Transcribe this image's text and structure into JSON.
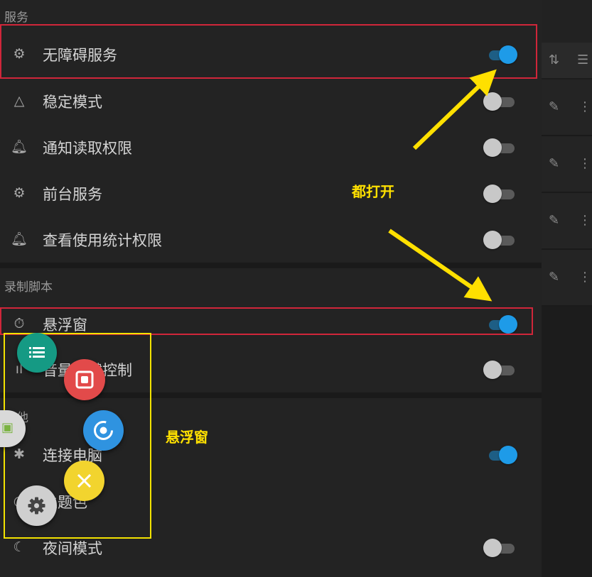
{
  "sections": {
    "services": "服务",
    "record_script": "录制脚本",
    "other": "其他"
  },
  "rows": {
    "accessibility": "无障碍服务",
    "stable_mode": "稳定模式",
    "notification_read": "通知读取权限",
    "foreground_service": "前台服务",
    "usage_stats": "查看使用统计权限",
    "floating_window": "悬浮窗",
    "volume_key_control": "音量上键控制",
    "connect_computer": "连接电脑",
    "theme_color": "主题色",
    "night_mode": "夜间模式"
  },
  "toggles": {
    "accessibility": true,
    "stable_mode": false,
    "notification_read": false,
    "foreground_service": false,
    "usage_stats": false,
    "floating_window": true,
    "volume_key_control": false,
    "connect_computer": true,
    "night_mode": false
  },
  "annotations": {
    "turn_all_on": "都打开",
    "floating_window": "悬浮窗"
  },
  "colors": {
    "toggle_on": "#1e9be8",
    "highlight_red": "#d0263a",
    "annotation_yellow": "#ffe000",
    "fab_list": "#159a84",
    "fab_record": "#e24a4a",
    "fab_target": "#2f93e0",
    "fab_close": "#f2d42e",
    "fab_settings": "#cfcfcf"
  },
  "icons": {
    "list": "list-icon",
    "record": "record-icon",
    "target": "target-icon",
    "close": "close-icon",
    "settings": "gear-icon"
  }
}
